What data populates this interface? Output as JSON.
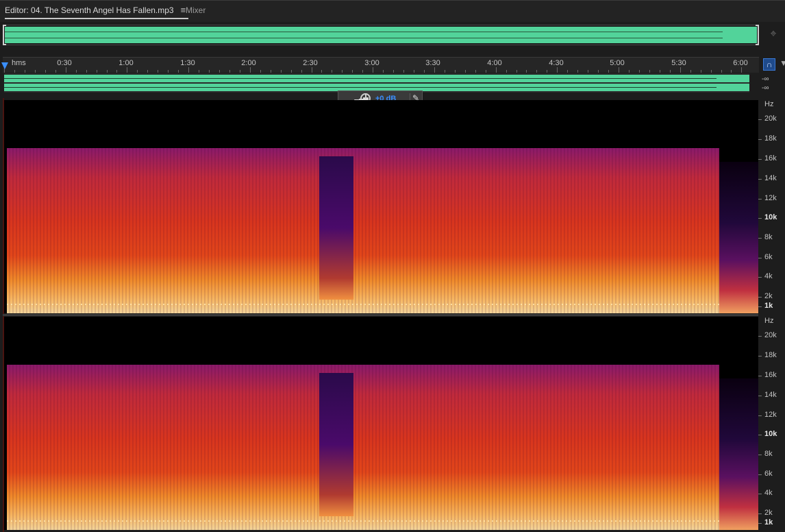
{
  "tabs": {
    "editor_label": "Editor: 04. The Seventh Angel Has Fallen.mp3",
    "editor_menu_icon": "hamburger-menu-icon",
    "mixer_label": "Mixer"
  },
  "ruler": {
    "unit_label": "hms",
    "ticks": [
      "0:30",
      "1:00",
      "1:30",
      "2:00",
      "2:30",
      "3:00",
      "3:30",
      "4:00",
      "4:30",
      "5:00",
      "5:30",
      "6:00"
    ]
  },
  "meters": {
    "left": "-∞",
    "right": "-∞"
  },
  "hud": {
    "gain_value": "+0 dB"
  },
  "freq_axis": {
    "unit": "Hz",
    "labels": [
      "20k",
      "18k",
      "16k",
      "14k",
      "12k",
      "10k",
      "8k",
      "6k",
      "4k",
      "2k",
      "1k"
    ]
  },
  "colors": {
    "waveform": "#52d39a",
    "accent": "#3a8fff"
  }
}
